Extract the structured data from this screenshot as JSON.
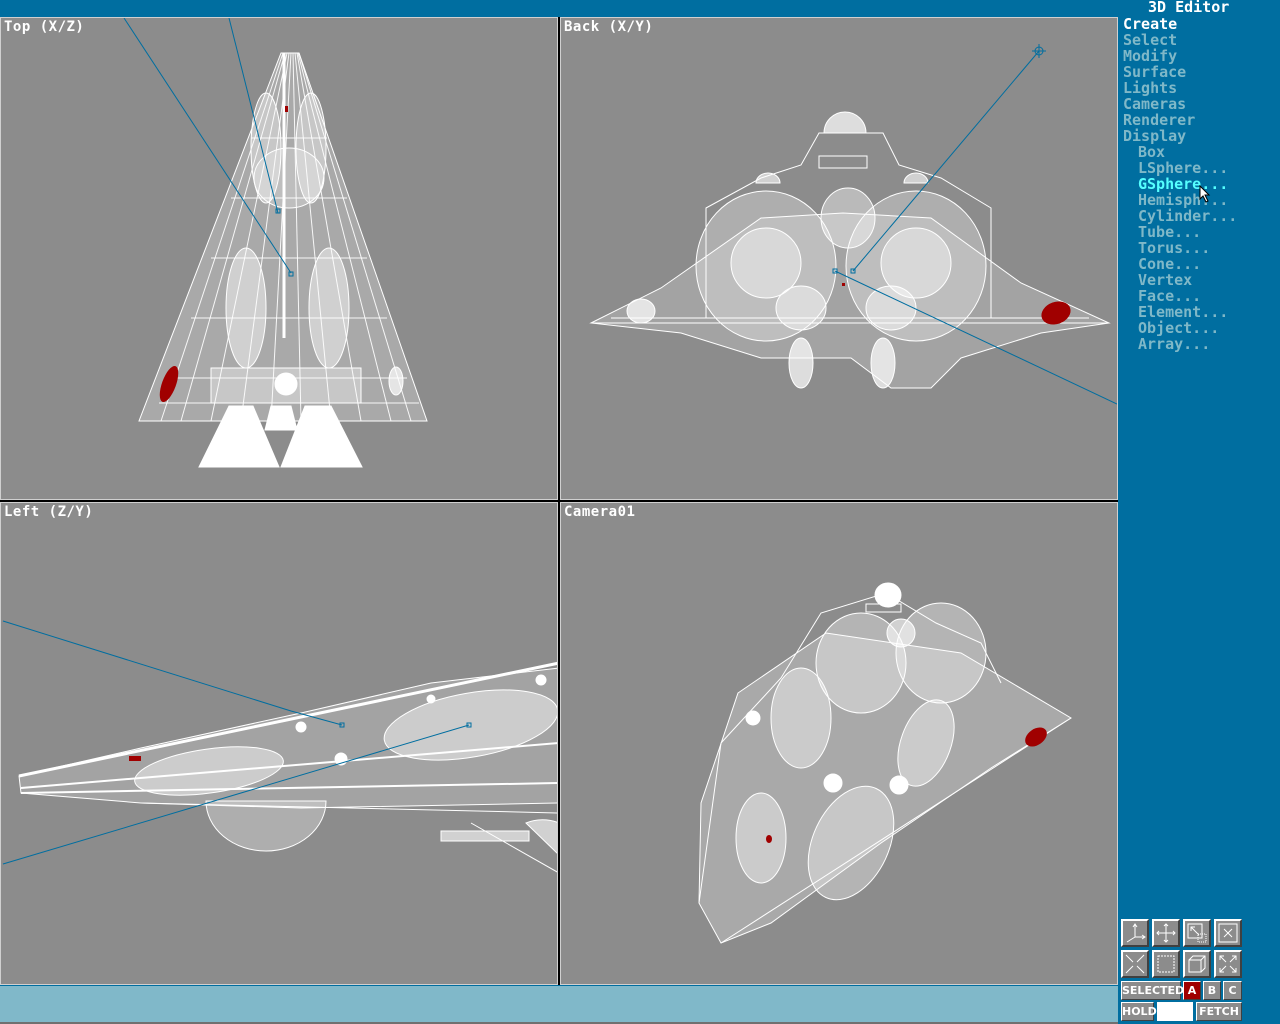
{
  "app": {
    "title": "3D Editor"
  },
  "viewports": [
    {
      "id": "top",
      "label": "Top (X/Z)"
    },
    {
      "id": "back",
      "label": "Back (X/Y)"
    },
    {
      "id": "left",
      "label": "Left (Z/Y)"
    },
    {
      "id": "camera",
      "label": "Camera01"
    }
  ],
  "menu": {
    "main": [
      {
        "label": "Create",
        "active": true
      },
      {
        "label": "Select"
      },
      {
        "label": "Modify"
      },
      {
        "label": "Surface"
      },
      {
        "label": "Lights"
      },
      {
        "label": "Cameras"
      },
      {
        "label": "Renderer"
      },
      {
        "label": "Display"
      }
    ],
    "sub": [
      {
        "label": "Box"
      },
      {
        "label": "LSphere..."
      },
      {
        "label": "GSphere...",
        "highlighted": true
      },
      {
        "label": "Hemisph..."
      },
      {
        "label": "Cylinder..."
      },
      {
        "label": "Tube..."
      },
      {
        "label": "Torus..."
      },
      {
        "label": "Cone..."
      },
      {
        "label": "Vertex"
      },
      {
        "label": "Face..."
      },
      {
        "label": "Element..."
      },
      {
        "label": "Object..."
      },
      {
        "label": "Array..."
      }
    ]
  },
  "toolbar": {
    "icons": [
      "axis-constraint-icon",
      "pan-icon",
      "zoom-window-icon",
      "zoom-extents-icon",
      "zoom-in-icon",
      "region-zoom-icon",
      "user-view-icon",
      "zoom-out-icon"
    ],
    "selected_label": "SELECTED",
    "sel_a": "A",
    "sel_b": "B",
    "sel_c": "C",
    "hold_label": "HOLD",
    "hold_value": "",
    "fetch_label": "FETCH"
  },
  "colors": {
    "panel_bg": "#006ea0",
    "viewport_bg": "#8c8c8c",
    "wire": "#ffffff",
    "selected": "#a00000",
    "camera_line": "#006ea0",
    "status_bg": "#80b8c9",
    "menu_inactive": "#7fb8c8",
    "menu_highlight": "#55ffff"
  }
}
